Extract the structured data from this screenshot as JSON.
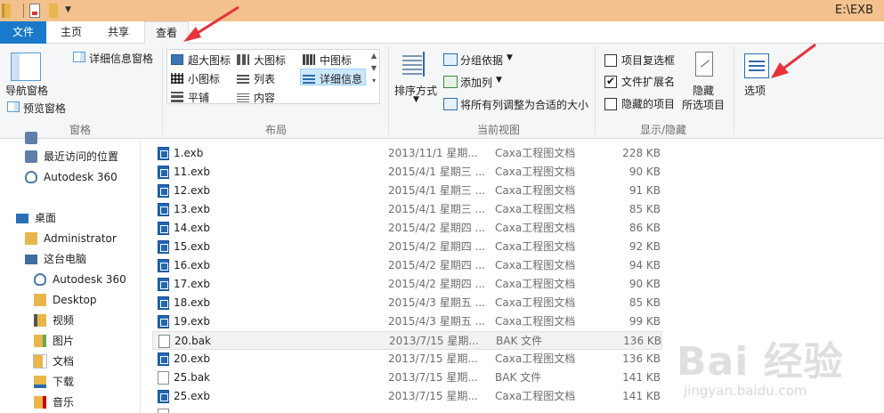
{
  "window": {
    "title": "E:\\EXB"
  },
  "tabs": [
    {
      "label": "文件"
    },
    {
      "label": "主页"
    },
    {
      "label": "共享"
    },
    {
      "label": "查看"
    }
  ],
  "ribbon": {
    "pane": {
      "nav_pane": "导航窗格",
      "preview_pane": "预览窗格",
      "details_pane": "详细信息窗格",
      "group": "窗格"
    },
    "layout": {
      "extra_large": "超大图标",
      "large": "大图标",
      "medium": "中图标",
      "small": "小图标",
      "list": "列表",
      "details": "详细信息",
      "tiles": "平铺",
      "content": "内容",
      "group": "布局"
    },
    "current_view": {
      "sort": "排序方式",
      "group_by": "分组依据",
      "add_columns": "添加列",
      "fit_columns": "将所有列调整为合适的大小",
      "group": "当前视图"
    },
    "show_hide": {
      "item_checkboxes": "项目复选框",
      "file_extensions": "文件扩展名",
      "hidden_items": "隐藏的项目",
      "hide_selected_1": "隐藏",
      "hide_selected_2": "所选项目",
      "group": "显示/隐藏",
      "checkbox_state": [
        false,
        true,
        false
      ]
    },
    "options": "选项"
  },
  "nav": [
    {
      "label": "最近访问的位置",
      "icon": "recent-icon"
    },
    {
      "label": "Autodesk 360",
      "icon": "cloud-icon"
    },
    {
      "label": "桌面",
      "icon": "desktop-icon"
    },
    {
      "label": "Administrator",
      "icon": "user-folder-icon"
    },
    {
      "label": "这台电脑",
      "icon": "computer-icon"
    },
    {
      "label": "Autodesk 360",
      "icon": "cloud-icon"
    },
    {
      "label": "Desktop",
      "icon": "folder-icon"
    },
    {
      "label": "视频",
      "icon": "video-folder-icon"
    },
    {
      "label": "图片",
      "icon": "picture-folder-icon"
    },
    {
      "label": "文档",
      "icon": "document-folder-icon"
    },
    {
      "label": "下载",
      "icon": "download-folder-icon"
    },
    {
      "label": "音乐",
      "icon": "music-folder-icon"
    }
  ],
  "files": [
    {
      "name": "1.exb",
      "date": "2013/11/1 星期...",
      "type": "Caxa工程图文档",
      "size": "228 KB",
      "kind": "exb"
    },
    {
      "name": "11.exb",
      "date": "2015/4/1 星期三 ...",
      "type": "Caxa工程图文档",
      "size": "90 KB",
      "kind": "exb"
    },
    {
      "name": "12.exb",
      "date": "2015/4/1 星期三 ...",
      "type": "Caxa工程图文档",
      "size": "91 KB",
      "kind": "exb"
    },
    {
      "name": "13.exb",
      "date": "2015/4/1 星期三 ...",
      "type": "Caxa工程图文档",
      "size": "85 KB",
      "kind": "exb"
    },
    {
      "name": "14.exb",
      "date": "2015/4/2 星期四 ...",
      "type": "Caxa工程图文档",
      "size": "86 KB",
      "kind": "exb"
    },
    {
      "name": "15.exb",
      "date": "2015/4/2 星期四 ...",
      "type": "Caxa工程图文档",
      "size": "92 KB",
      "kind": "exb"
    },
    {
      "name": "16.exb",
      "date": "2015/4/2 星期四 ...",
      "type": "Caxa工程图文档",
      "size": "94 KB",
      "kind": "exb"
    },
    {
      "name": "17.exb",
      "date": "2015/4/2 星期四 ...",
      "type": "Caxa工程图文档",
      "size": "90 KB",
      "kind": "exb"
    },
    {
      "name": "18.exb",
      "date": "2015/4/3 星期五 ...",
      "type": "Caxa工程图文档",
      "size": "85 KB",
      "kind": "exb"
    },
    {
      "name": "19.exb",
      "date": "2015/4/3 星期五 ...",
      "type": "Caxa工程图文档",
      "size": "99 KB",
      "kind": "exb"
    },
    {
      "name": "20.bak",
      "date": "2013/7/15 星期...",
      "type": "BAK 文件",
      "size": "136 KB",
      "kind": "bak"
    },
    {
      "name": "20.exb",
      "date": "2013/7/15 星期...",
      "type": "Caxa工程图文档",
      "size": "136 KB",
      "kind": "exb"
    },
    {
      "name": "25.bak",
      "date": "2013/7/15 星期...",
      "type": "BAK 文件",
      "size": "141 KB",
      "kind": "bak"
    },
    {
      "name": "25.exb",
      "date": "2013/7/15 星期...",
      "type": "Caxa工程图文档",
      "size": "141 KB",
      "kind": "exb"
    }
  ],
  "watermark": {
    "main": "Bai 经验",
    "sub": "jingyan.baidu.com"
  },
  "colors": {
    "accent": "#1979ca",
    "titlebar": "#f3c18d",
    "arrow": "#e8323c"
  }
}
